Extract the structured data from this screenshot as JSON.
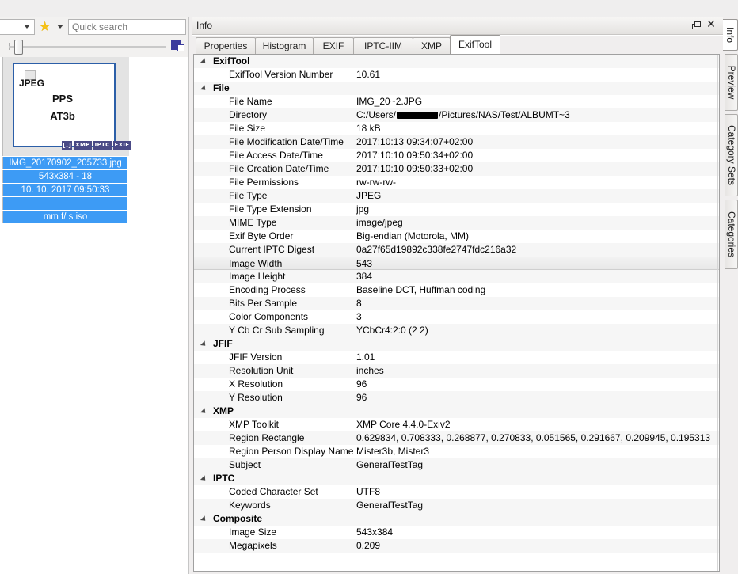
{
  "left_panel": {
    "combo_value": "",
    "star_icon": "star-icon",
    "search": {
      "placeholder": "Quick search",
      "value": ""
    },
    "thumbnail": {
      "format_label": "JPEG",
      "line1": "PPS",
      "line2": "AT3b",
      "badges": [
        "[.]",
        "XMP",
        "IPTC",
        "EXIF"
      ]
    },
    "meta_lines": [
      "IMG_20170902_205733.jpg",
      "543x384 - 18",
      "10. 10. 2017 09:50:33",
      "",
      "mm f/ s iso"
    ]
  },
  "info": {
    "title": "Info",
    "float_button": "float-button",
    "close_button": "close-button",
    "tabs": [
      {
        "label": "Properties",
        "active": false
      },
      {
        "label": "Histogram",
        "active": false
      },
      {
        "label": "EXIF",
        "active": false
      },
      {
        "label": "IPTC-IIM",
        "active": false
      },
      {
        "label": "XMP",
        "active": false
      },
      {
        "label": "ExifTool",
        "active": true
      }
    ],
    "rows": [
      {
        "type": "group",
        "label": "ExifTool"
      },
      {
        "type": "item",
        "label": "ExifTool Version Number",
        "value": "10.61"
      },
      {
        "type": "group",
        "label": "File"
      },
      {
        "type": "item",
        "label": "File Name",
        "value": "IMG_20~2.JPG"
      },
      {
        "type": "item",
        "label": "Directory",
        "value_pre": "C:/Users/",
        "redacted": true,
        "value_post": "/Pictures/NAS/Test/ALBUMT~3"
      },
      {
        "type": "item",
        "label": "File Size",
        "value": "18 kB"
      },
      {
        "type": "item",
        "label": "File Modification Date/Time",
        "value": "2017:10:13 09:34:07+02:00"
      },
      {
        "type": "item",
        "label": "File Access Date/Time",
        "value": "2017:10:10 09:50:34+02:00"
      },
      {
        "type": "item",
        "label": "File Creation Date/Time",
        "value": "2017:10:10 09:50:33+02:00"
      },
      {
        "type": "item",
        "label": "File Permissions",
        "value": "rw-rw-rw-"
      },
      {
        "type": "item",
        "label": "File Type",
        "value": "JPEG"
      },
      {
        "type": "item",
        "label": "File Type Extension",
        "value": "jpg"
      },
      {
        "type": "item",
        "label": "MIME Type",
        "value": "image/jpeg"
      },
      {
        "type": "item",
        "label": "Exif Byte Order",
        "value": "Big-endian (Motorola, MM)"
      },
      {
        "type": "item",
        "label": "Current IPTC Digest",
        "value": "0a27f65d19892c338fe2747fdc216a32"
      },
      {
        "type": "item",
        "label": "Image Width",
        "value": "543",
        "selected": true
      },
      {
        "type": "item",
        "label": "Image Height",
        "value": "384"
      },
      {
        "type": "item",
        "label": "Encoding Process",
        "value": "Baseline DCT, Huffman coding"
      },
      {
        "type": "item",
        "label": "Bits Per Sample",
        "value": "8"
      },
      {
        "type": "item",
        "label": "Color Components",
        "value": "3"
      },
      {
        "type": "item",
        "label": "Y Cb Cr Sub Sampling",
        "value": "YCbCr4:2:0 (2 2)"
      },
      {
        "type": "group",
        "label": "JFIF"
      },
      {
        "type": "item",
        "label": "JFIF Version",
        "value": "1.01"
      },
      {
        "type": "item",
        "label": "Resolution Unit",
        "value": "inches"
      },
      {
        "type": "item",
        "label": "X Resolution",
        "value": "96"
      },
      {
        "type": "item",
        "label": "Y Resolution",
        "value": "96"
      },
      {
        "type": "group",
        "label": "XMP"
      },
      {
        "type": "item",
        "label": "XMP Toolkit",
        "value": "XMP Core 4.4.0-Exiv2"
      },
      {
        "type": "item",
        "label": "Region Rectangle",
        "value": "0.629834, 0.708333, 0.268877, 0.270833, 0.051565, 0.291667, 0.209945, 0.195313"
      },
      {
        "type": "item",
        "label": "Region Person Display Name",
        "value": "Mister3b, Mister3"
      },
      {
        "type": "item",
        "label": "Subject",
        "value": "GeneralTestTag"
      },
      {
        "type": "group",
        "label": "IPTC"
      },
      {
        "type": "item",
        "label": "Coded Character Set",
        "value": "UTF8"
      },
      {
        "type": "item",
        "label": "Keywords",
        "value": "GeneralTestTag"
      },
      {
        "type": "group",
        "label": "Composite"
      },
      {
        "type": "item",
        "label": "Image Size",
        "value": "543x384"
      },
      {
        "type": "item",
        "label": "Megapixels",
        "value": "0.209"
      }
    ]
  },
  "vertical_tabs": [
    {
      "label": "Info",
      "active": true
    },
    {
      "label": "Preview",
      "active": false
    },
    {
      "label": "Category Sets",
      "active": false
    },
    {
      "label": "Categories",
      "active": false
    }
  ],
  "colors": {
    "selection_blue": "#3d9bf5",
    "badge": "#4a4a86",
    "thumb_border": "#2c5fa8",
    "star": "#f5c116"
  }
}
